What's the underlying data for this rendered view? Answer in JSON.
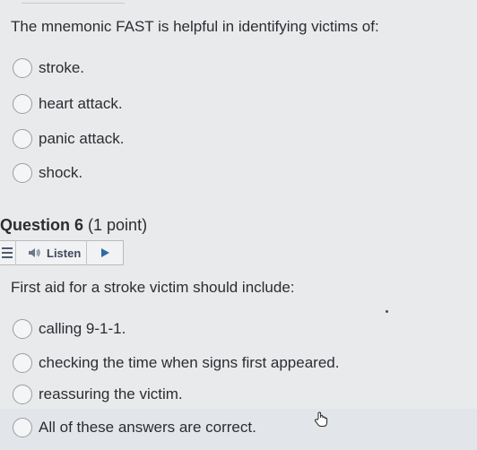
{
  "question5": {
    "prompt": "The mnemonic FAST is helpful in identifying victims of:",
    "options": [
      "stroke.",
      "heart attack.",
      "panic attack.",
      "shock."
    ]
  },
  "question6": {
    "heading": "Question 6",
    "points": "(1 point)",
    "listen_label": "Listen",
    "prompt": "First aid for a stroke victim should include:",
    "options": [
      "calling 9-1-1.",
      "checking the time when signs first appeared.",
      "reassuring the victim.",
      "All of these answers are correct."
    ]
  },
  "icons": {
    "menu": "hamburger-menu-icon",
    "speaker": "speaker-icon",
    "play": "play-icon",
    "cursor": "hand-pointer-icon"
  },
  "colors": {
    "accent": "#2d6aa8",
    "background": "#e9eaec",
    "text": "#2b2d31"
  }
}
